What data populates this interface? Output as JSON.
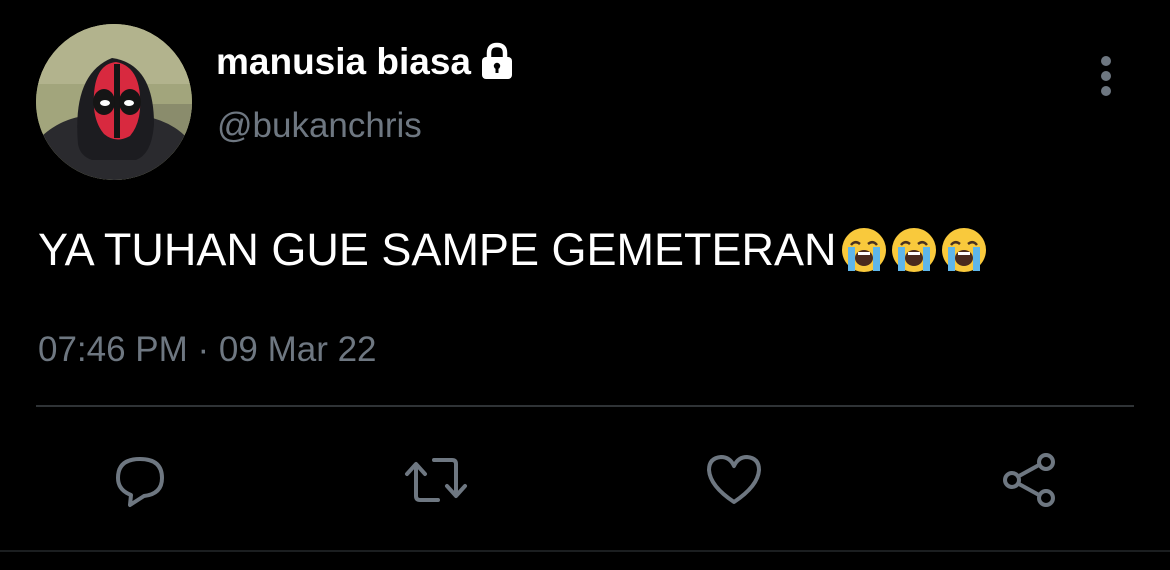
{
  "user": {
    "display_name": "manusia biasa",
    "handle": "@bukanchris",
    "protected_icon": "lock-icon",
    "avatar_icon": "deadpool-mask-avatar"
  },
  "tweet": {
    "text": "YA TUHAN GUE SAMPE GEMETERAN",
    "emojis": [
      "loudly-crying-face",
      "loudly-crying-face",
      "loudly-crying-face"
    ],
    "timestamp": "07:46 PM · 09 Mar 22"
  },
  "actions": {
    "reply_icon": "speech-bubble-icon",
    "retweet_icon": "retweet-icon",
    "like_icon": "heart-icon",
    "share_icon": "share-icon",
    "more_icon": "vertical-dots-icon"
  },
  "colors": {
    "background": "#000000",
    "text_primary": "#ffffff",
    "text_secondary": "#6e7781",
    "divider": "#2f3336"
  }
}
